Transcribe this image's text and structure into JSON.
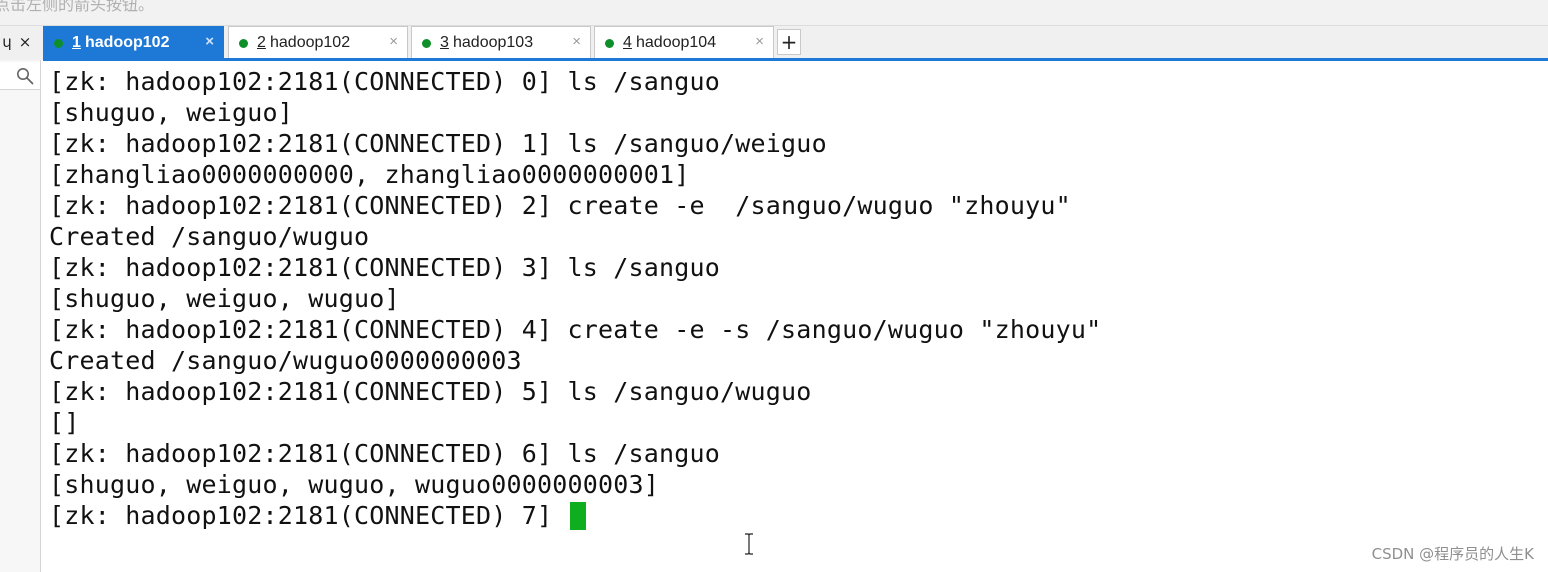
{
  "hint_bar": {
    "text": "点击左侧的箭头按钮。"
  },
  "left_controls": {
    "pin": "ɥ",
    "close": "×"
  },
  "tabs": [
    {
      "number": "1",
      "name": "hadoop102",
      "active": true,
      "close": "×"
    },
    {
      "number": "2",
      "name": "hadoop102",
      "active": false,
      "close": "×"
    },
    {
      "number": "3",
      "name": "hadoop103",
      "active": false,
      "close": "×"
    },
    {
      "number": "4",
      "name": "hadoop104",
      "active": false,
      "close": "×"
    }
  ],
  "add_tab": "+",
  "terminal": {
    "lines": [
      "[zk: hadoop102:2181(CONNECTED) 0] ls /sanguo",
      "[shuguo, weiguo]",
      "[zk: hadoop102:2181(CONNECTED) 1] ls /sanguo/weiguo",
      "[zhangliao0000000000, zhangliao0000000001]",
      "[zk: hadoop102:2181(CONNECTED) 2] create -e  /sanguo/wuguo \"zhouyu\"",
      "Created /sanguo/wuguo",
      "[zk: hadoop102:2181(CONNECTED) 3] ls /sanguo",
      "[shuguo, weiguo, wuguo]",
      "[zk: hadoop102:2181(CONNECTED) 4] create -e -s /sanguo/wuguo \"zhouyu\"",
      "Created /sanguo/wuguo0000000003",
      "[zk: hadoop102:2181(CONNECTED) 5] ls /sanguo/wuguo",
      "[]",
      "[zk: hadoop102:2181(CONNECTED) 6] ls /sanguo",
      "[shuguo, weiguo, wuguo, wuguo0000000003]",
      "[zk: hadoop102:2181(CONNECTED) 7] "
    ],
    "cursor_color": "#0fae1f"
  },
  "watermark": "CSDN @程序员的人生K",
  "colors": {
    "accent": "#1e78d6",
    "status_dot": "#0f8f2a"
  }
}
